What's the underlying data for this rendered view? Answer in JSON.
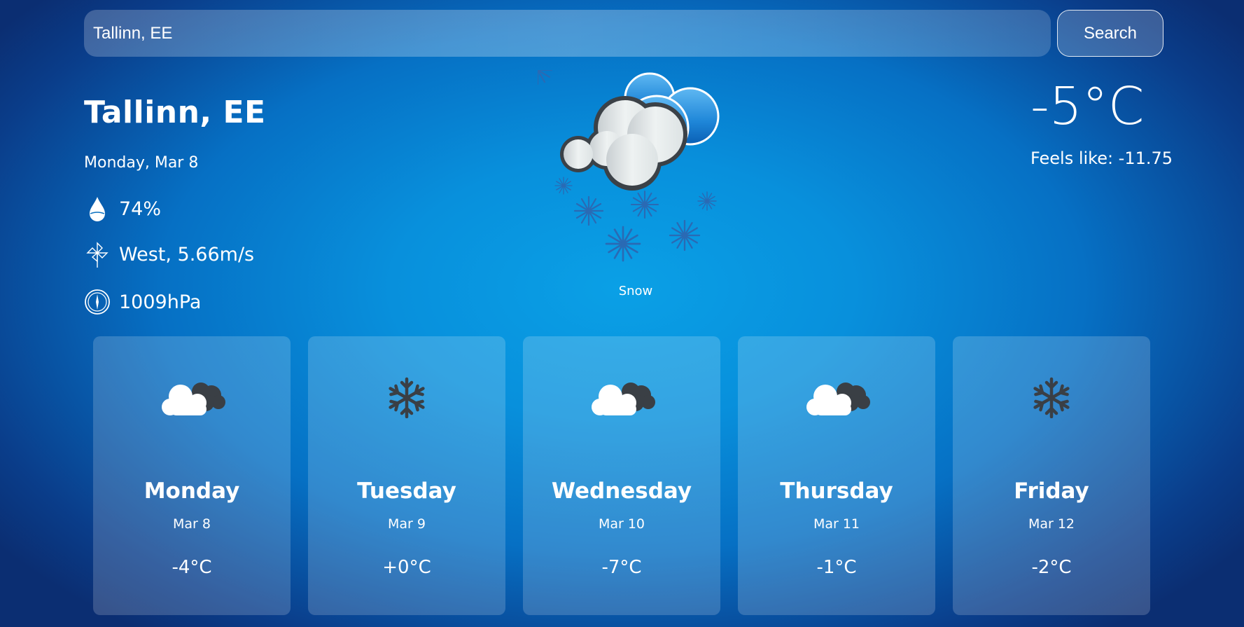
{
  "search": {
    "value": "Tallinn, EE",
    "button_label": "Search"
  },
  "current": {
    "city": "Tallinn, EE",
    "date": "Monday, Mar 8",
    "humidity": "74%",
    "wind": "West, 5.66m/s",
    "pressure": "1009hPa",
    "condition": "Snow",
    "temperature": "-5°C",
    "feels_like": "Feels like: -11.75",
    "icon": "snow-cloud-icon"
  },
  "forecast": [
    {
      "day": "Monday",
      "date": "Mar 8",
      "temp": "-4°C",
      "icon": "cloudy-icon"
    },
    {
      "day": "Tuesday",
      "date": "Mar 9",
      "temp": "+0°C",
      "icon": "snowflake-icon"
    },
    {
      "day": "Wednesday",
      "date": "Mar 10",
      "temp": "-7°C",
      "icon": "cloudy-icon"
    },
    {
      "day": "Thursday",
      "date": "Mar 11",
      "temp": "-1°C",
      "icon": "cloudy-icon"
    },
    {
      "day": "Friday",
      "date": "Mar 12",
      "temp": "-2°C",
      "icon": "snowflake-icon"
    }
  ],
  "colors": {
    "background": "#0890dc",
    "icon_dark": "#3a3f45"
  }
}
